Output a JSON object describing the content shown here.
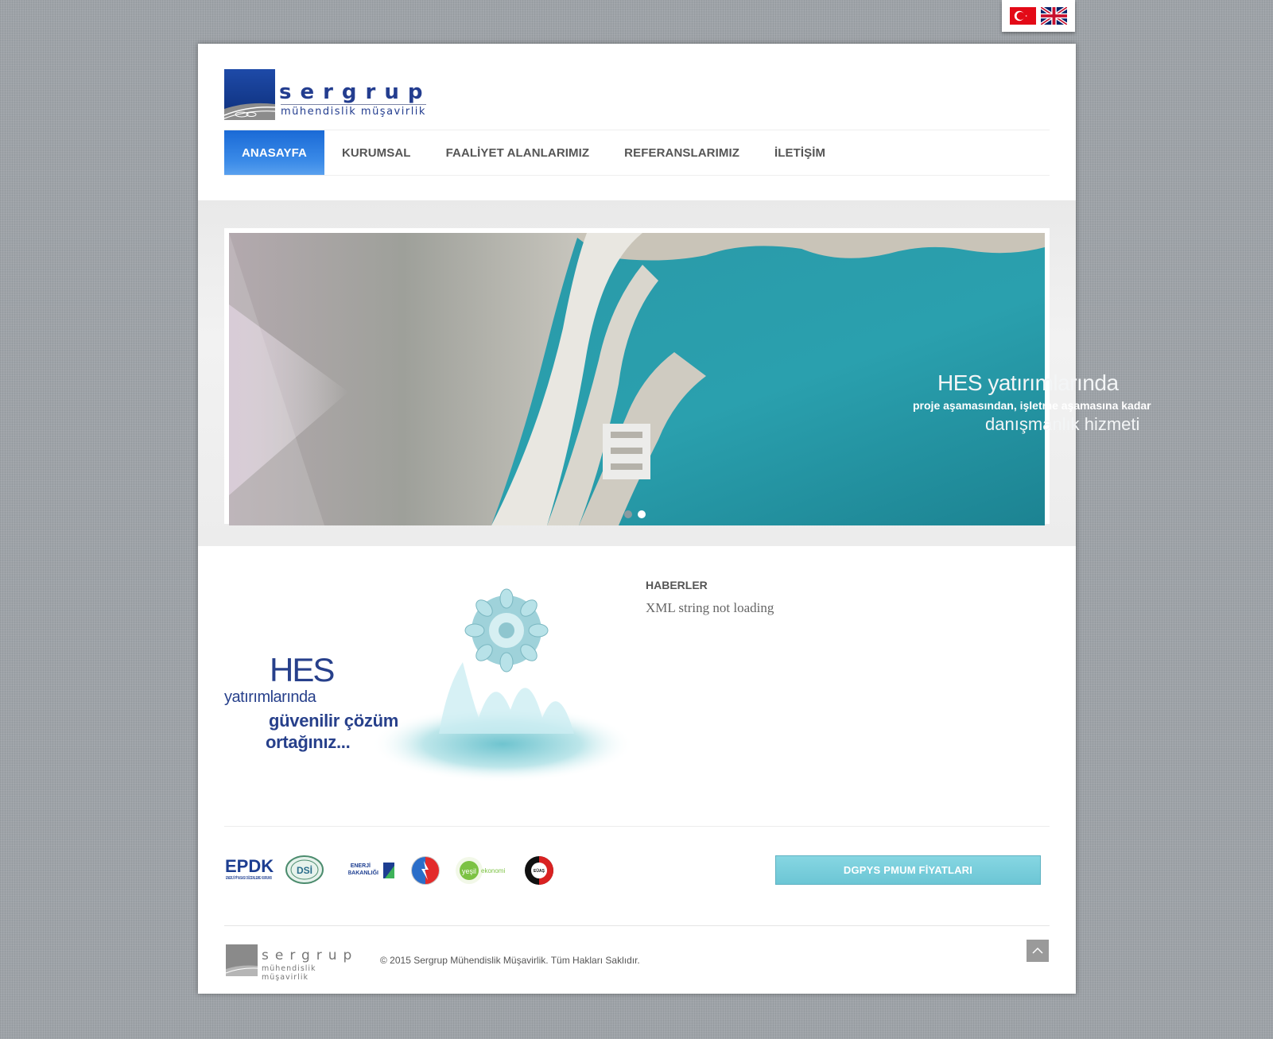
{
  "language_switcher": {
    "flags": [
      "turkish-flag",
      "uk-flag"
    ]
  },
  "header": {
    "logo_word": "sergrup",
    "logo_sub": "mühendislik müşavirlik"
  },
  "nav": {
    "items": [
      "ANASAYFA",
      "KURUMSAL",
      "FAALİYET ALANLARIMIZ",
      "REFERANSLARIMIZ",
      "İLETİŞİM"
    ],
    "active_index": 0
  },
  "hero": {
    "line1": "HES yatırımlarında",
    "line2": "proje aşamasından, işletme aşamasına kadar",
    "line3": "danışmanlık hizmeti",
    "slide_count": 2,
    "active_slide": 2
  },
  "promo": {
    "line1": "HES",
    "line2": "yatırımlarında",
    "line3": "güvenilir çözüm",
    "line4": "ortağınız..."
  },
  "news": {
    "title": "HABERLER",
    "message": "XML string not loading"
  },
  "partners": {
    "epdk": "EPDK",
    "epdk_sub": "ENERJİ PİYASASI DÜZENLEME KURUMU",
    "dsi": "DSİ",
    "enerji_line1": "ENERJİ",
    "enerji_line2": "BAKANLIĞI",
    "yesil_1": "yeşil",
    "yesil_2": "ekonomi",
    "euas": "EÜAŞ"
  },
  "pmum_button": "DGPYS PMUM FİYATLARI",
  "footer": {
    "logo_word": "sergrup",
    "logo_sub": "mühendislik müşavirlik",
    "copyright": "© 2015 Sergrup Mühendislik Müşavirlik. Tüm Hakları Saklıdır."
  },
  "colors": {
    "brand_blue": "#233d8f",
    "nav_active": "#2f7fe0",
    "pmum_button": "#76cfdc",
    "background": "#9ea3a8"
  }
}
